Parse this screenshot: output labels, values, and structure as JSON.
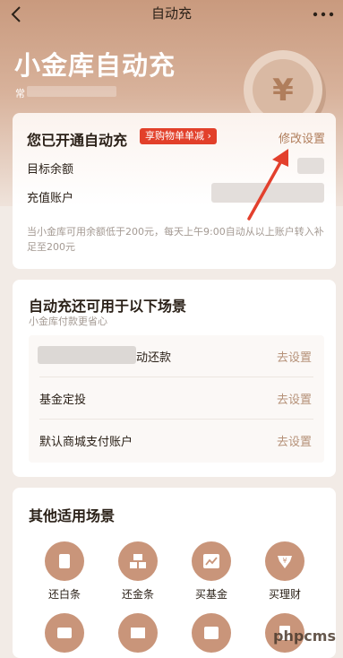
{
  "topbar": {
    "title": "自动充"
  },
  "hero": {
    "title": "小金库自动充",
    "subtitle_prefix": "常"
  },
  "status_card": {
    "title": "您已开通自动充",
    "badge": "享购物单单减 ›",
    "modify_link": "修改设置",
    "target_label": "目标余额",
    "account_label": "充值账户",
    "note": "当小金库可用余额低于200元，每天上午9:00自动从以上账户转入补足至200元"
  },
  "scenarios": {
    "title": "自动充还可用于以下场景",
    "subtitle": "小金库付款更省心",
    "items": [
      {
        "label": "动还款",
        "action": "去设置"
      },
      {
        "label": "基金定投",
        "action": "去设置"
      },
      {
        "label": "默认商城支付账户",
        "action": "去设置"
      }
    ]
  },
  "other": {
    "title": "其他适用场景",
    "items": [
      {
        "label": "还白条",
        "icon": "card-icon"
      },
      {
        "label": "还金条",
        "icon": "bars-icon"
      },
      {
        "label": "买基金",
        "icon": "chart-icon"
      },
      {
        "label": "买理财",
        "icon": "yen-gem-icon"
      }
    ]
  },
  "watermark": "phpcms",
  "colors": {
    "accent": "#b07e5c",
    "badge": "#e2402a",
    "icon_bg": "#c9957a"
  }
}
